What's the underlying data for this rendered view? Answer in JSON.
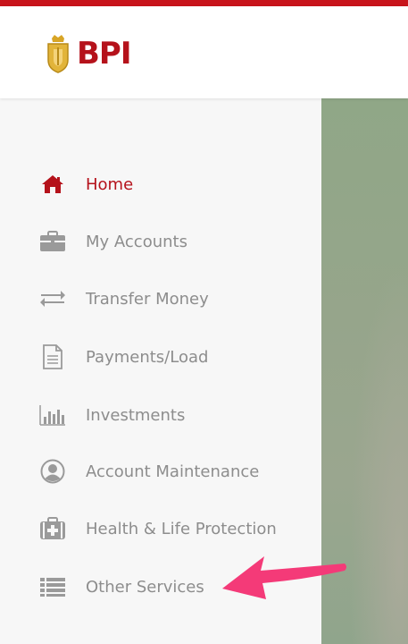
{
  "brand": {
    "name": "BPI",
    "accent_color": "#b5121b",
    "top_bar_color": "#c8141b"
  },
  "nav": {
    "items": [
      {
        "label": "Home",
        "icon": "home-icon",
        "active": true
      },
      {
        "label": "My Accounts",
        "icon": "briefcase-icon",
        "active": false
      },
      {
        "label": "Transfer Money",
        "icon": "transfer-arrows-icon",
        "active": false
      },
      {
        "label": "Payments/Load",
        "icon": "document-icon",
        "active": false
      },
      {
        "label": "Investments",
        "icon": "bar-chart-icon",
        "active": false
      },
      {
        "label": "Account Maintenance",
        "icon": "user-circle-icon",
        "active": false
      },
      {
        "label": "Health & Life Protection",
        "icon": "medical-kit-icon",
        "active": false
      },
      {
        "label": "Other Services",
        "icon": "list-icon",
        "active": false
      }
    ]
  },
  "annotation": {
    "arrow_color": "#f43a78",
    "points_to": "Other Services"
  }
}
